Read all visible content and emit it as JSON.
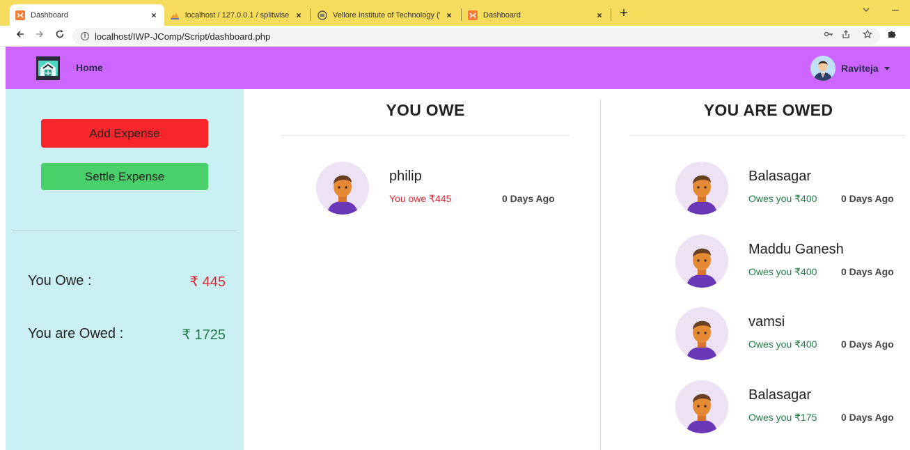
{
  "browser": {
    "tabs": [
      {
        "title": "Dashboard",
        "icon": "xampp-icon",
        "active": true
      },
      {
        "title": "localhost / 127.0.0.1 / splitwise /",
        "icon": "phpmyadmin-icon",
        "active": false
      },
      {
        "title": "Vellore Institute of Technology (V",
        "icon": "vit-icon",
        "active": false
      },
      {
        "title": "Dashboard",
        "icon": "xampp-icon",
        "active": false
      }
    ],
    "close_glyph": "×",
    "new_tab_glyph": "+",
    "url": "localhost/IWP-JComp/Script/dashboard.php",
    "accent": "#f6dc5c"
  },
  "navbar": {
    "home_label": "Home",
    "user_name": "Raviteja",
    "color": "#cc66ff"
  },
  "sidebar": {
    "add_expense_label": "Add Expense",
    "settle_expense_label": "Settle Expense",
    "you_owe_label": "You Owe :",
    "you_owe_value": "₹ 445",
    "you_are_owed_label": "You are Owed :",
    "you_are_owed_value": "₹ 1725"
  },
  "you_owe": {
    "title": "YOU OWE",
    "items": [
      {
        "name": "philip",
        "amount": "You owe ₹445",
        "ago": "0 Days Ago"
      }
    ]
  },
  "you_are_owed": {
    "title": "YOU ARE OWED",
    "items": [
      {
        "name": "Balasagar",
        "amount": "Owes you ₹400",
        "ago": "0 Days Ago"
      },
      {
        "name": "Maddu Ganesh",
        "amount": "Owes you ₹400",
        "ago": "0 Days Ago"
      },
      {
        "name": "vamsi",
        "amount": "Owes you ₹400",
        "ago": "0 Days Ago"
      },
      {
        "name": "Balasagar",
        "amount": "Owes you ₹175",
        "ago": "0 Days Ago"
      }
    ]
  }
}
